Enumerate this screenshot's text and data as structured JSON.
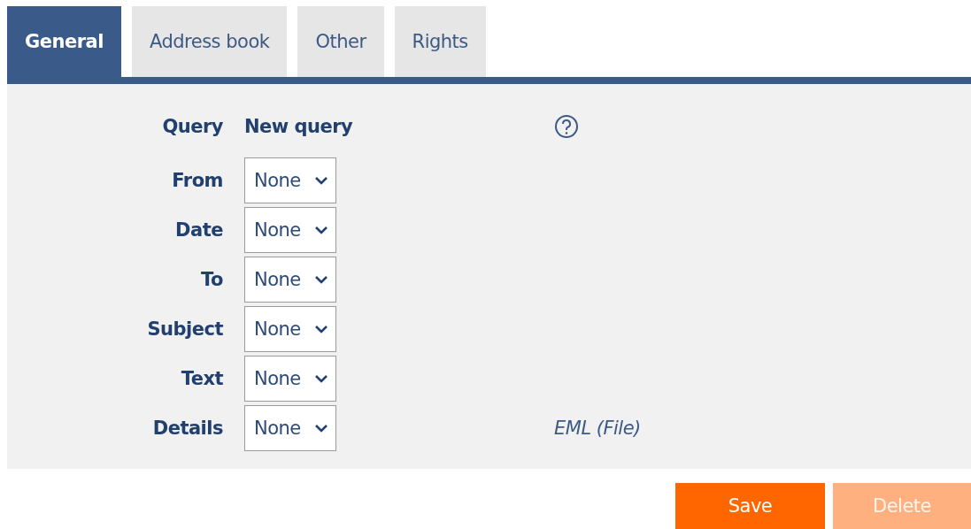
{
  "tabs": [
    {
      "label": "General",
      "selected": true
    },
    {
      "label": "Address book",
      "selected": false
    },
    {
      "label": "Other",
      "selected": false
    },
    {
      "label": "Rights",
      "selected": false
    }
  ],
  "query": {
    "label": "Query",
    "value": "New query"
  },
  "fields": [
    {
      "label": "From",
      "value": "None"
    },
    {
      "label": "Date",
      "value": "None"
    },
    {
      "label": "To",
      "value": "None"
    },
    {
      "label": "Subject",
      "value": "None"
    },
    {
      "label": "Text",
      "value": "None"
    },
    {
      "label": "Details",
      "value": "None",
      "note": "EML (File)"
    }
  ],
  "buttons": [
    {
      "label": "Save",
      "disabled": false
    },
    {
      "label": "Delete",
      "disabled": true
    }
  ]
}
